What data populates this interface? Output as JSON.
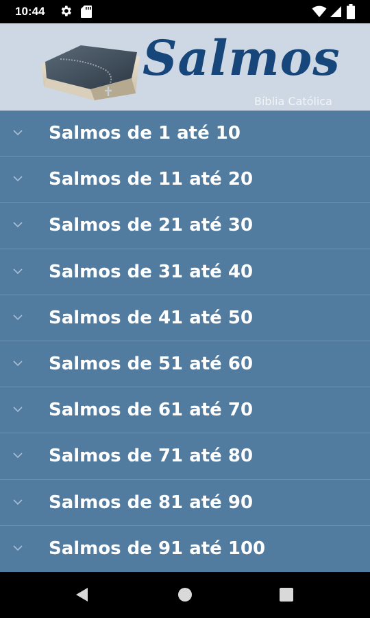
{
  "status_bar": {
    "time": "10:44",
    "icons": [
      "gear-icon",
      "sd-card-icon",
      "wifi-icon",
      "cell-signal-icon",
      "battery-icon"
    ]
  },
  "header": {
    "title": "Salmos",
    "subtitle": "Bíblia Católica",
    "logo": "bible-rosary-logo"
  },
  "list": {
    "items": [
      {
        "label": "Salmos de 1 até 10"
      },
      {
        "label": "Salmos de 11 até 20"
      },
      {
        "label": "Salmos de 21 até 30"
      },
      {
        "label": "Salmos de 31 até 40"
      },
      {
        "label": "Salmos de 41 até 50"
      },
      {
        "label": "Salmos de 51 até 60"
      },
      {
        "label": "Salmos de 61 até 70"
      },
      {
        "label": "Salmos de 71 até 80"
      },
      {
        "label": "Salmos de 81 até 90"
      },
      {
        "label": "Salmos de 91 até 100"
      }
    ]
  },
  "nav_bar": {
    "buttons": [
      "back-icon",
      "home-icon",
      "recents-icon"
    ]
  },
  "colors": {
    "list_background": "#527ba0",
    "header_background": "#cdd8e4",
    "title_color": "#16467a",
    "divider": "#6e92b3"
  }
}
